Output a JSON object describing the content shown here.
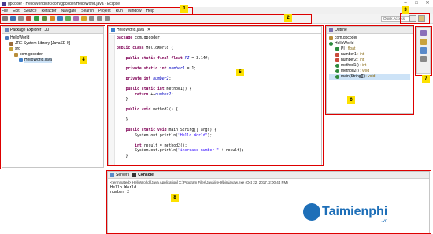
{
  "window": {
    "title": "gpcoder - HelloWorld/src/com/gpcoder/HelloWorld.java - Eclipse"
  },
  "menu": [
    "File",
    "Edit",
    "Source",
    "Refactor",
    "Navigate",
    "Search",
    "Project",
    "Run",
    "Window",
    "Help"
  ],
  "toolbar": {
    "quick_access": "Quick Access"
  },
  "package_explorer": {
    "title": "Package Explorer",
    "tab2": "Ju",
    "tree": [
      "HelloWorld",
      "JRE System Library [JavaSE-9]",
      "src",
      "com.gpcoder",
      "HelloWorld.java"
    ]
  },
  "editor": {
    "tab": "HelloWorld.java",
    "lines": [
      [
        "package com.gpcoder;",
        ""
      ],
      [
        "",
        ""
      ],
      [
        "public class HelloWorld {",
        ""
      ],
      [
        "",
        ""
      ],
      [
        "    public static final float PI = 3.14f;",
        ""
      ],
      [
        "",
        ""
      ],
      [
        "    private static int number1 = 1;",
        ""
      ],
      [
        "",
        ""
      ],
      [
        "    private int number2;",
        ""
      ],
      [
        "",
        ""
      ],
      [
        "    public static int method1() {",
        ""
      ],
      [
        "        return ++number2;",
        ""
      ],
      [
        "    }",
        ""
      ],
      [
        "",
        ""
      ],
      [
        "    public void method2() {",
        ""
      ],
      [
        "",
        ""
      ],
      [
        "    }",
        ""
      ],
      [
        "",
        ""
      ],
      [
        "    public static void main(String[] args) {",
        ""
      ],
      [
        "        System.out.println(\"Hello World\");",
        ""
      ],
      [
        "",
        ""
      ],
      [
        "        int result = method2();",
        ""
      ],
      [
        "        System.out.println(\"increase number \" + result);",
        ""
      ],
      [
        "    }",
        ""
      ]
    ]
  },
  "outline": {
    "title": "Outline",
    "rows": [
      {
        "label": "com.gpcoder",
        "type": ""
      },
      {
        "label": "HelloWorld",
        "type": ""
      },
      {
        "label": "PI",
        "type": ": float"
      },
      {
        "label": "number1",
        "type": ": int"
      },
      {
        "label": "number2",
        "type": ": int"
      },
      {
        "label": "method1()",
        "type": ": int"
      },
      {
        "label": "method2()",
        "type": ": void"
      },
      {
        "label": "main(String[])",
        "type": ": void"
      }
    ]
  },
  "console": {
    "tab1": "Servers",
    "tab2": "Console",
    "status": "<terminated> HelloWorld [Java Application] C:\\Program Files\\Java\\jre-9\\bin\\javaw.exe (Oct 22, 2017, 2:00:44 PM)",
    "output": [
      "Hello World",
      "number 2"
    ]
  },
  "callouts": [
    "1",
    "2",
    "3",
    "4",
    "5",
    "6",
    "7",
    "8"
  ],
  "watermark": {
    "brand": "Taimienphi",
    "tld": ".vn"
  },
  "colors": {
    "callout": "#fde100",
    "box": "#dd0000",
    "keyword": "#7f0055",
    "string": "#2a00ff"
  }
}
